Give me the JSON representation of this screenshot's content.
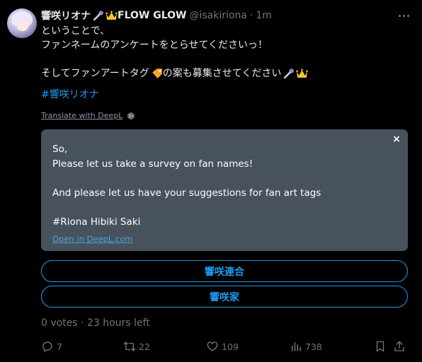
{
  "tweet": {
    "display_name": "響咲リオナ",
    "name_suffix": "FLOW GLOW",
    "handle": "@isakiriona",
    "separator": "·",
    "time": "1m",
    "name_emojis": [
      "microphone-icon",
      "crown-icon"
    ],
    "lines": [
      "ということで、",
      "ファンネームのアンケートをとらせてくださいっ！",
      "",
      "そしてファンアートタグ",
      "の案も募集させてください"
    ],
    "hashtag": "#響咲リオナ",
    "translate_label": "Translate with DeepL"
  },
  "translation": {
    "close": "×",
    "lines": [
      "So,",
      "Please let us take a survey on fan names!",
      "",
      "And please let us have your suggestions for fan art tags",
      "",
      "#Riona Hibiki Saki"
    ],
    "open_link": "Open in DeepL.com"
  },
  "poll": {
    "options": [
      "響咲連合",
      "響咲家"
    ],
    "meta": "0 votes · 23 hours left"
  },
  "actions": {
    "replies": "7",
    "retweets": "22",
    "likes": "109",
    "views": "738"
  },
  "colors": {
    "accent": "#1d9bf0",
    "muted": "#71767b",
    "panel": "#48525c",
    "background": "#000000"
  }
}
